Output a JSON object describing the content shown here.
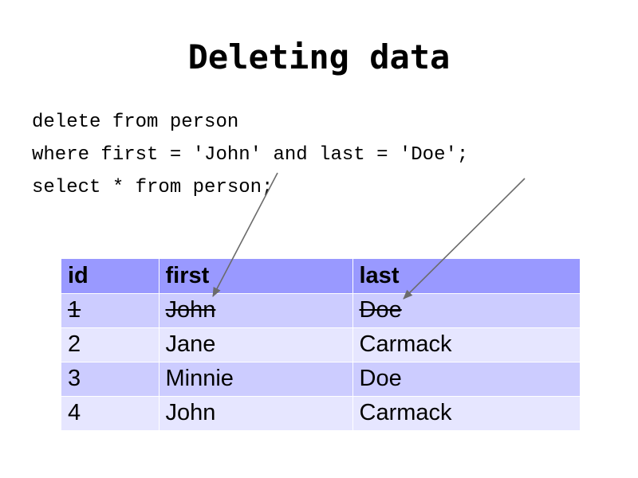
{
  "title": "Deleting data",
  "code": [
    "delete from person",
    "where first = 'John' and last = 'Doe';",
    "select * from person;"
  ],
  "table": {
    "headers": [
      "id",
      "first",
      "last"
    ],
    "rows": [
      {
        "id": "1",
        "first": "John",
        "last": "Doe",
        "deleted": true
      },
      {
        "id": "2",
        "first": "Jane",
        "last": "Carmack",
        "deleted": false
      },
      {
        "id": "3",
        "first": "Minnie",
        "last": "Doe",
        "deleted": false
      },
      {
        "id": "4",
        "first": "John",
        "last": "Carmack",
        "deleted": false
      }
    ]
  },
  "colors": {
    "header_bg": "#9999ff",
    "deleted_row_bg": "#ccccff",
    "row_bg_light": "#e6e6ff",
    "row_bg_mid": "#ccccff",
    "arrow": "#6b6b6b"
  }
}
